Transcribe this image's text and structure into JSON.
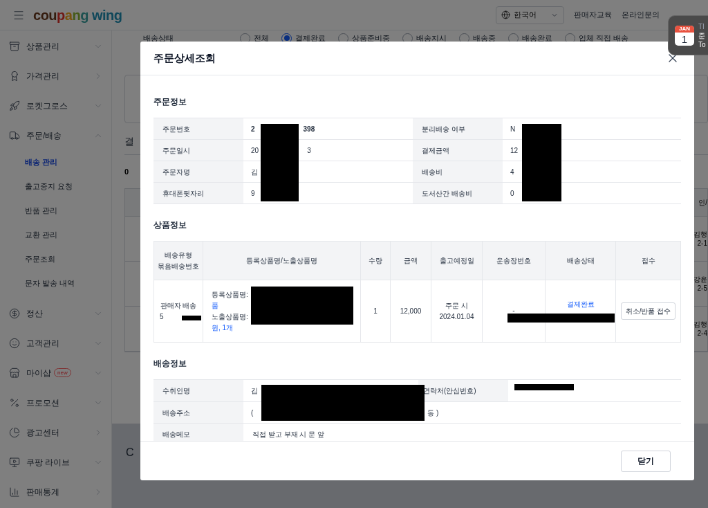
{
  "header": {
    "logo": "coupang wing",
    "language": "한국어",
    "links": [
      "판매자교육",
      "온라인문의"
    ]
  },
  "notification": {
    "month": "JAN",
    "day": "1",
    "lines": [
      "TI",
      "준",
      "To"
    ]
  },
  "sidebar": {
    "items": [
      {
        "label": "상품관리",
        "kind": "group",
        "expanded": false
      },
      {
        "label": "가격관리",
        "kind": "link"
      },
      {
        "label": "로켓그로스",
        "kind": "group",
        "expanded": false
      },
      {
        "label": "주문/배송",
        "kind": "group",
        "expanded": true,
        "children": [
          {
            "label": "배송 관리",
            "selected": true
          },
          {
            "label": "출고중지 요청",
            "selected": false
          },
          {
            "label": "반품 관리",
            "selected": false
          },
          {
            "label": "교환 관리",
            "selected": false
          },
          {
            "label": "주문조회",
            "selected": false
          },
          {
            "label": "문자 발송 내역",
            "selected": false
          }
        ]
      },
      {
        "label": "정산",
        "kind": "group",
        "expanded": false
      },
      {
        "label": "고객관리",
        "kind": "group",
        "expanded": false
      },
      {
        "label": "마이샵",
        "kind": "group",
        "expanded": false,
        "badge": "new"
      },
      {
        "label": "프로모션",
        "kind": "group",
        "expanded": false
      },
      {
        "label": "광고센터",
        "kind": "link"
      },
      {
        "label": "쿠팡 라이브",
        "kind": "group",
        "expanded": false
      },
      {
        "label": "판매통계",
        "kind": "link"
      }
    ]
  },
  "filter": {
    "label": "배송상태",
    "options": [
      {
        "label": "전체",
        "selected": false
      },
      {
        "label": "결제완료",
        "selected": true
      },
      {
        "label": "상품준비중",
        "selected": false
      },
      {
        "label": "배송지시",
        "selected": false
      },
      {
        "label": "배송중",
        "selected": false
      },
      {
        "label": "배송완료",
        "selected": false
      },
      {
        "label": "업체 직접 배송",
        "selected": false
      }
    ]
  },
  "background": {
    "heading": "결",
    "count": "0",
    "column_header": "인/",
    "rows": [
      [
        "김행",
        "2-1"
      ],
      [
        "강윤",
        "2-5"
      ],
      [
        "김행",
        "2-4"
      ]
    ],
    "footer_fragment": "C"
  },
  "modal": {
    "title": "주문상세조회",
    "order_info": {
      "title": "주문정보",
      "rows": [
        [
          {
            "label": "주문번호",
            "value": "2",
            "value_tail": "398",
            "bold": true
          },
          {
            "label": "분리배송 여부",
            "value": "N"
          }
        ],
        [
          {
            "label": "주문일시",
            "value": "20",
            "value_tail": "3"
          },
          {
            "label": "결제금액",
            "value": "12"
          }
        ],
        [
          {
            "label": "주문자명",
            "value": "김"
          },
          {
            "label": "배송비",
            "value": "4"
          }
        ],
        [
          {
            "label": "휴대폰뒷자리",
            "value": "9"
          },
          {
            "label": "도서산간 배송비",
            "value": "0"
          }
        ]
      ]
    },
    "product_info": {
      "title": "상품정보",
      "columns": [
        [
          "배송유형",
          "묶음배송번호"
        ],
        [
          "등록상품명/노출상품명"
        ],
        [
          "수량"
        ],
        [
          "금액"
        ],
        [
          "출고예정일"
        ],
        [
          "운송장번호"
        ],
        [
          "배송상태"
        ],
        [
          "접수"
        ]
      ],
      "rows": [
        {
          "delivery_type": "판매자 배송",
          "bundle_no": "5",
          "registered_label": "등록상품명:",
          "registered_name": "품",
          "exposed_label": "노출상품명:",
          "exposed_name": "원, 1개",
          "quantity": "1",
          "amount": "12,000",
          "ship_date": [
            "주문 시",
            "2024.01.04"
          ],
          "tracking": "-",
          "status": "결제완료",
          "action": "취소/반품 접수"
        }
      ]
    },
    "delivery_info": {
      "title": "배송정보",
      "recipient_label": "수취인명",
      "recipient": "김",
      "contact_label": "연락처(안심번호)",
      "address_label": "배송주소",
      "address_start": "(",
      "address_end": "동 )",
      "memo_label": "배송메모",
      "memo": "직접 받고 부재 시 문 앞"
    },
    "close_button": "닫기"
  }
}
